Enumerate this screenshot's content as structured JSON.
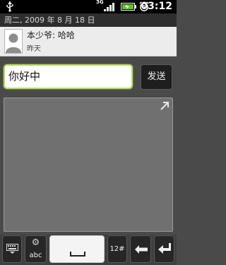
{
  "status_bar": {
    "network_type": "3G",
    "time": "03:12",
    "icons": [
      "usb-icon",
      "signal-icon",
      "battery-icon",
      "alarm-icon"
    ]
  },
  "date_header": "周二, 2009 年 8 月 18 日",
  "message": {
    "sender_and_text": "本少爷: 哈哈",
    "time": "昨天",
    "avatar_icon": "default-contact-icon"
  },
  "compose": {
    "input_value": "你好中",
    "send_label": "发送",
    "focus_color": "#b8dc5a"
  },
  "handwriting": {
    "expand_icon": "expand-arrow-icon"
  },
  "keyboard": {
    "settings_label": "abc",
    "symbols_label": "12#",
    "icons": [
      "keyboard-hide-icon",
      "gear-icon",
      "space-icon",
      "backspace-icon",
      "enter-icon"
    ]
  }
}
